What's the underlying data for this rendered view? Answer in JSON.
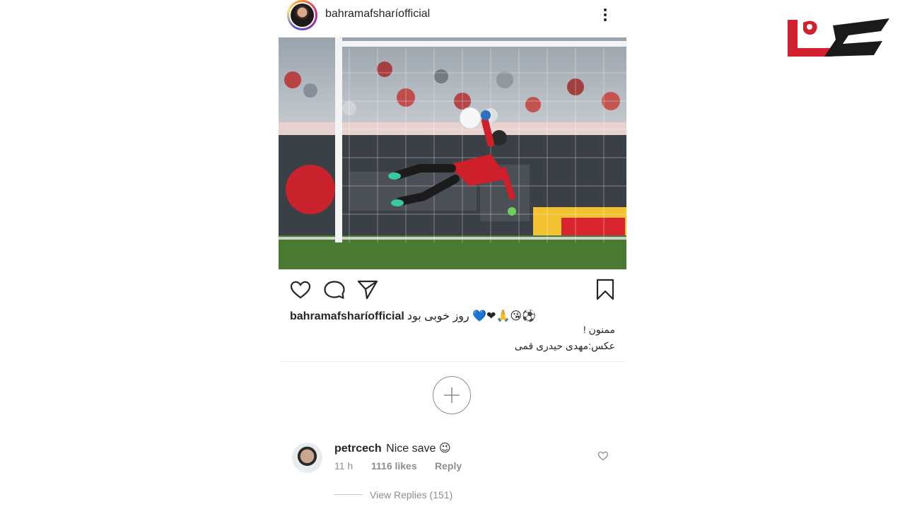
{
  "post": {
    "username": "bahramafsharíofficial",
    "caption": {
      "username": "bahramafsharíofficial",
      "line1": "روز خوبی بود 💙❤🙏😘⚽",
      "line2": "ممنون !",
      "line3": "عکس:مهدی حیدری قمی"
    }
  },
  "comment": {
    "username": "petrcech",
    "text": "Nice save 😉",
    "time": "11 h",
    "likes": "1116 likes",
    "reply_label": "Reply",
    "view_replies": "View Replies (151)"
  },
  "icons": {
    "header": [
      "avatar",
      "more-options-icon"
    ],
    "actions": [
      "heart-icon",
      "comment-icon",
      "share-icon",
      "bookmark-icon"
    ],
    "load_more": "plus-icon",
    "comment_like": "heart-icon"
  },
  "colors": {
    "text": "#262626",
    "secondary": "#8e8e8e",
    "logo_red": "#d3202f",
    "logo_black": "#1a1a1a"
  }
}
